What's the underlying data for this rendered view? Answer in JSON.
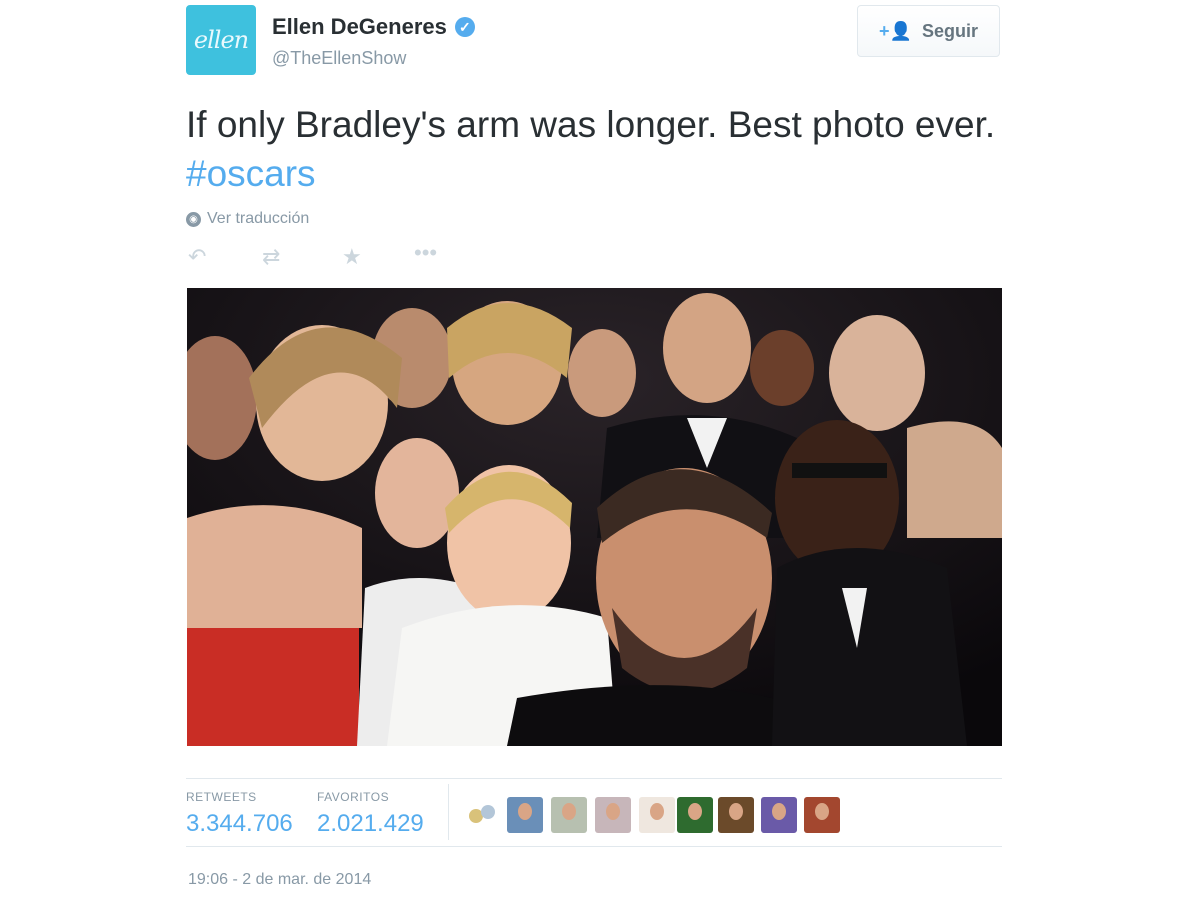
{
  "author": {
    "avatar_text": "ellen",
    "name": "Ellen DeGeneres",
    "handle": "@TheEllenShow",
    "verified_icon": "verified-badge-icon"
  },
  "follow_button": {
    "label": "Seguir",
    "icon": "add-user-icon"
  },
  "tweet": {
    "text": "If only Bradley's arm was longer. Best photo ever.",
    "hashtag": "#oscars"
  },
  "translate_link": "Ver traducción",
  "actions": [
    "reply-icon",
    "retweet-icon",
    "favorite-icon",
    "more-icon"
  ],
  "photo": {
    "description_icon": "group-selfie-photo"
  },
  "stats": {
    "retweets_label": "RETWEETS",
    "retweets_value": "3.344.706",
    "favorites_label": "FAVORITOS",
    "favorites_value": "2.021.429"
  },
  "timestamp": "19:06 - 2 de mar. de 2014",
  "colors": {
    "accent": "#55acee",
    "avatar_bg": "#3ec1de",
    "muted": "#8899a6",
    "text": "#292f33"
  }
}
